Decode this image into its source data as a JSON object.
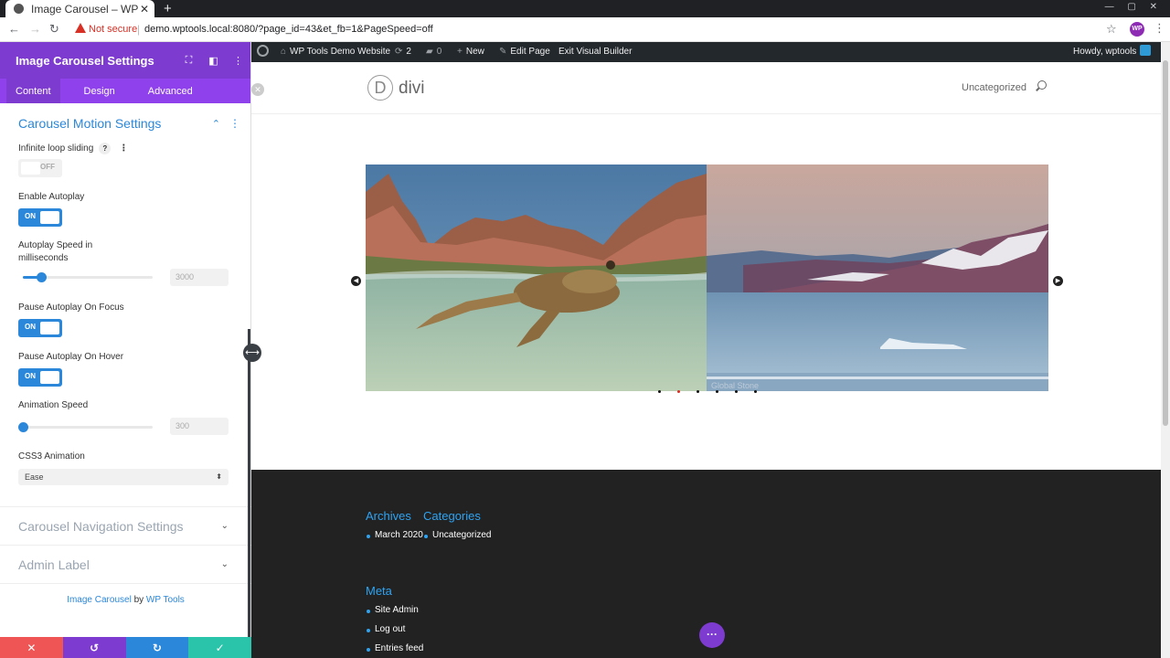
{
  "browser": {
    "tab_title": "Image Carousel – WP To",
    "tab_close": "✕",
    "new_tab": "+",
    "security_label": "Not secure",
    "url": "demo.wptools.local:8080/?page_id=43&et_fb=1&PageSpeed=off",
    "profile_initials": "WP",
    "window_controls": "— ▢ ✕"
  },
  "wp_admin_bar": {
    "site_name": "WP Tools Demo Website",
    "updates_count": "2",
    "comments_count": "0",
    "new_label": "New",
    "edit_page_label": "Edit Page",
    "exit_builder_label": "Exit Visual Builder",
    "howdy": "Howdy, wptools"
  },
  "panel": {
    "title": "Image Carousel Settings",
    "tabs": [
      {
        "label": "Content",
        "active": true
      },
      {
        "label": "Design",
        "active": false
      },
      {
        "label": "Advanced",
        "active": false
      }
    ],
    "group_title": "Carousel Motion Settings",
    "fields": {
      "infinite_loop": {
        "label": "Infinite loop sliding",
        "state": "OFF"
      },
      "autoplay": {
        "label": "Enable Autoplay",
        "state": "ON"
      },
      "autoplay_speed": {
        "label": "Autoplay Speed in milliseconds",
        "value": "3000",
        "fraction": 0.14
      },
      "pause_focus": {
        "label": "Pause Autoplay On Focus",
        "state": "ON"
      },
      "pause_hover": {
        "label": "Pause Autoplay On Hover",
        "state": "ON"
      },
      "animation_speed": {
        "label": "Animation Speed",
        "value": "300",
        "fraction": 0.0
      },
      "css3_animation": {
        "label": "CSS3 Animation",
        "value": "Ease"
      }
    },
    "collapsed_groups": [
      "Carousel Navigation Settings",
      "Admin Label"
    ],
    "credit": {
      "product": "Image Carousel",
      "by": "by",
      "vendor": "WP Tools"
    }
  },
  "site": {
    "logo_letter": "D",
    "logo_text": "divi",
    "nav_item": "Uncategorized"
  },
  "carousel": {
    "caption": "Global Stone",
    "slide_count": 6,
    "active_dot": 1
  },
  "footer": {
    "archives_title": "Archives",
    "archives_item": "March 2020",
    "categories_title": "Categories",
    "categories_item": "Uncategorized",
    "meta_title": "Meta",
    "meta_items": [
      "Site Admin",
      "Log out",
      "Entries feed"
    ]
  },
  "colors": {
    "builder_purple": "#7e3bd0",
    "divi_blue": "#2b87da",
    "cancel_red": "#ef5555",
    "undo_purple": "#7e3bd0",
    "redo_blue": "#2b87da",
    "save_green": "#29c4a9"
  }
}
